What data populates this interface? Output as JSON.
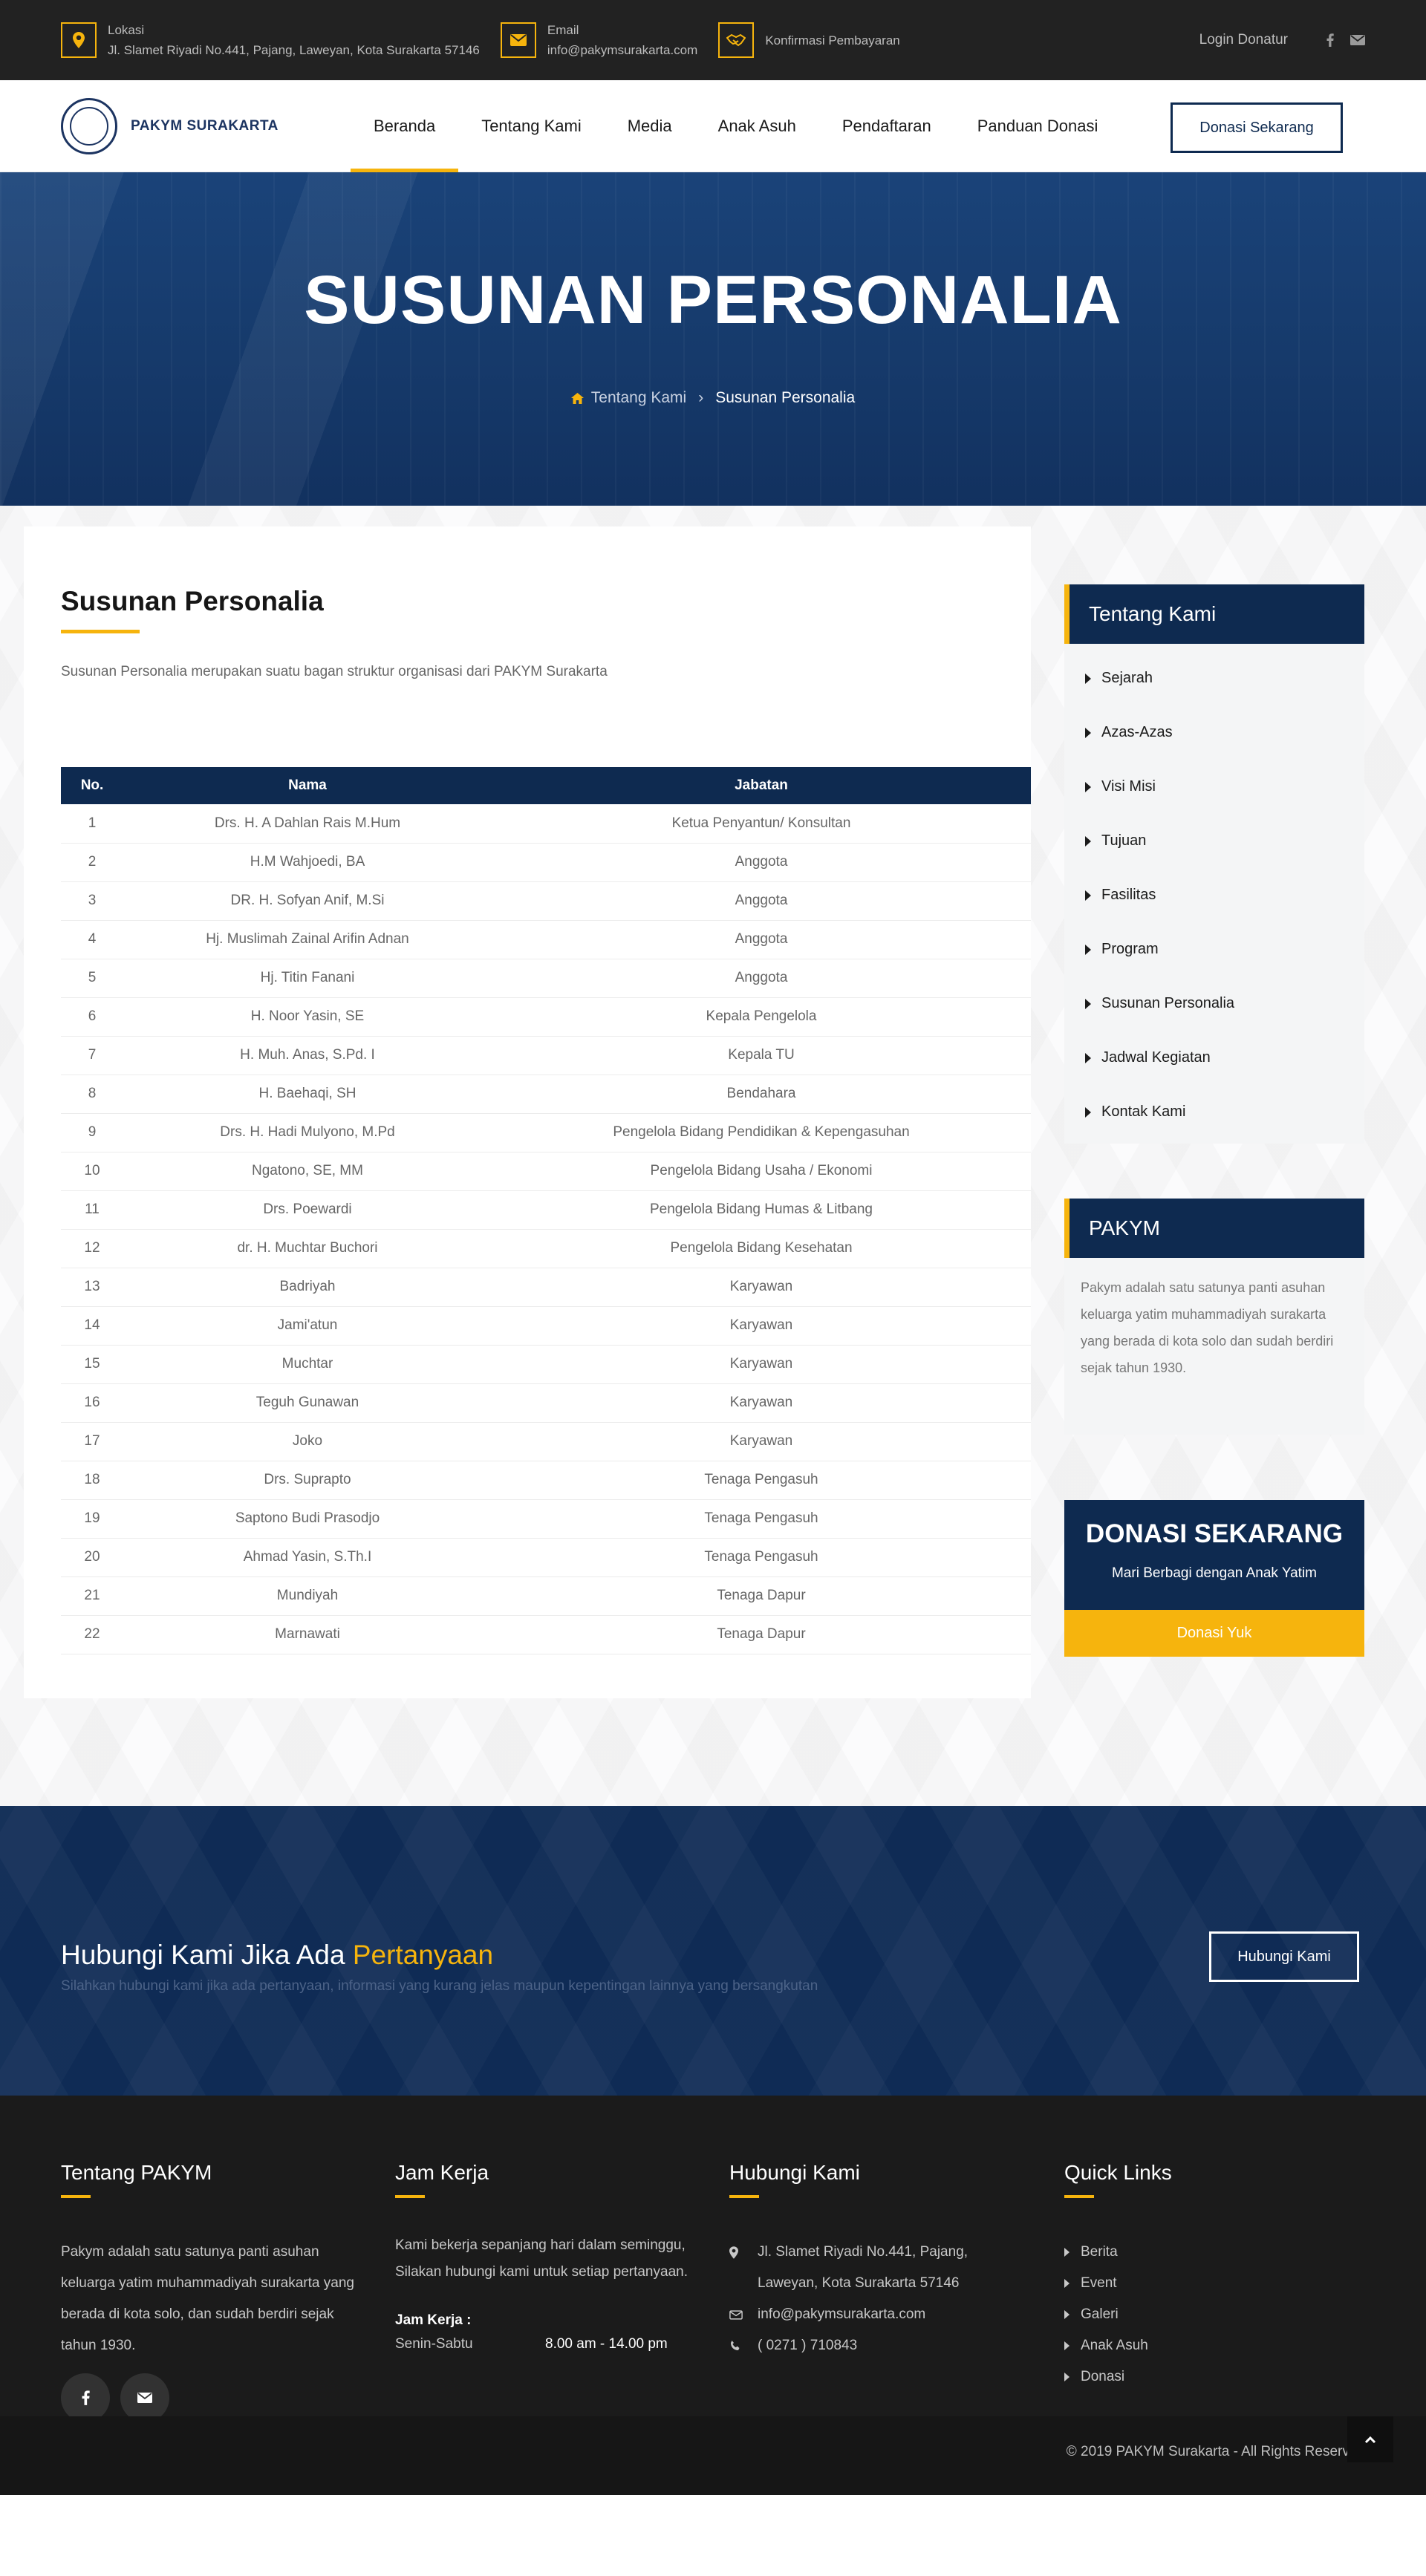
{
  "topbar": {
    "location_label": "Lokasi",
    "location_value": "Jl. Slamet Riyadi No.441, Pajang, Laweyan, Kota Surakarta 57146",
    "email_label": "Email",
    "email_value": "info@pakymsurakarta.com",
    "payment_label": "Konfirmasi Pembayaran",
    "login_label": "Login Donatur"
  },
  "nav": {
    "logo_text": "PAKYM SURAKARTA",
    "items": [
      "Beranda",
      "Tentang Kami",
      "Media",
      "Anak Asuh",
      "Pendaftaran",
      "Panduan Donasi"
    ],
    "active_index": 0,
    "cta_label": "Donasi Sekarang"
  },
  "hero": {
    "title": "SUSUNAN PERSONALIA",
    "breadcrumb_parent": "Tentang Kami",
    "breadcrumb_current": "Susunan Personalia"
  },
  "content": {
    "title": "Susunan Personalia",
    "description": "Susunan Personalia merupakan suatu bagan struktur organisasi dari PAKYM Surakarta",
    "table": {
      "headers": [
        "No.",
        "Nama",
        "Jabatan"
      ],
      "rows": [
        [
          "1",
          "Drs. H. A Dahlan Rais M.Hum",
          "Ketua Penyantun/ Konsultan"
        ],
        [
          "2",
          "H.M Wahjoedi, BA",
          "Anggota"
        ],
        [
          "3",
          "DR. H. Sofyan Anif, M.Si",
          "Anggota"
        ],
        [
          "4",
          "Hj. Muslimah Zainal Arifin Adnan",
          "Anggota"
        ],
        [
          "5",
          "Hj. Titin Fanani",
          "Anggota"
        ],
        [
          "6",
          "H. Noor Yasin, SE",
          "Kepala Pengelola"
        ],
        [
          "7",
          "H. Muh. Anas, S.Pd. I",
          "Kepala TU"
        ],
        [
          "8",
          "H. Baehaqi, SH",
          "Bendahara"
        ],
        [
          "9",
          "Drs. H. Hadi Mulyono, M.Pd",
          "Pengelola Bidang Pendidikan & Kepengasuhan"
        ],
        [
          "10",
          "Ngatono, SE, MM",
          "Pengelola Bidang Usaha / Ekonomi"
        ],
        [
          "11",
          "Drs. Poewardi",
          "Pengelola Bidang Humas & Litbang"
        ],
        [
          "12",
          "dr. H. Muchtar Buchori",
          "Pengelola Bidang Kesehatan"
        ],
        [
          "13",
          "Badriyah",
          "Karyawan"
        ],
        [
          "14",
          "Jami'atun",
          "Karyawan"
        ],
        [
          "15",
          "Muchtar",
          "Karyawan"
        ],
        [
          "16",
          "Teguh Gunawan",
          "Karyawan"
        ],
        [
          "17",
          "Joko",
          "Karyawan"
        ],
        [
          "18",
          "Drs. Suprapto",
          "Tenaga Pengasuh"
        ],
        [
          "19",
          "Saptono Budi Prasodjo",
          "Tenaga Pengasuh"
        ],
        [
          "20",
          "Ahmad Yasin, S.Th.I",
          "Tenaga Pengasuh"
        ],
        [
          "21",
          "Mundiyah",
          "Tenaga Dapur"
        ],
        [
          "22",
          "Marnawati",
          "Tenaga Dapur"
        ]
      ]
    }
  },
  "sidebar": {
    "about_title": "Tentang Kami",
    "about_items": [
      "Sejarah",
      "Azas-Azas",
      "Visi Misi",
      "Tujuan",
      "Fasilitas",
      "Program",
      "Susunan Personalia",
      "Jadwal Kegiatan",
      "Kontak Kami"
    ],
    "pakym_title": "PAKYM",
    "pakym_text": "Pakym adalah satu satunya panti asuhan keluarga yatim muhammadiyah surakarta yang berada di kota solo dan sudah berdiri sejak tahun 1930.",
    "donate_title": "DONASI SEKARANG",
    "donate_subtitle": "Mari Berbagi dengan Anak Yatim",
    "donate_button": "Donasi Yuk"
  },
  "cta": {
    "title_main": "Hubungi Kami Jika Ada ",
    "title_accent": "Pertanyaan",
    "subtitle": "Silahkan hubungi kami jika ada pertanyaan, informasi yang kurang jelas maupun kepentingan lainnya yang bersangkutan",
    "button": "Hubungi Kami"
  },
  "footer": {
    "about_title": "Tentang PAKYM",
    "about_text": "Pakym adalah satu satunya panti asuhan keluarga yatim muhammadiyah surakarta yang berada di kota solo, dan sudah berdiri sejak tahun 1930.",
    "hours_title": "Jam Kerja",
    "hours_text": "Kami bekerja sepanjang hari dalam seminggu, Silakan hubungi kami untuk setiap pertanyaan.",
    "hours_label": "Jam Kerja :",
    "hours_days": "Senin-Sabtu",
    "hours_time": "8.00 am - 14.00 pm",
    "contact_title": "Hubungi Kami",
    "contact_address": "Jl. Slamet Riyadi No.441, Pajang, Laweyan, Kota Surakarta 57146",
    "contact_email": "info@pakymsurakarta.com",
    "contact_phone": "( 0271 ) 710843",
    "links_title": "Quick Links",
    "links": [
      "Berita",
      "Event",
      "Galeri",
      "Anak Asuh",
      "Donasi"
    ],
    "copyright": "© 2019 PAKYM Surakarta - All Rights Reserved"
  },
  "colors": {
    "accent": "#f6b40d",
    "navy": "#0e2a50",
    "dark": "#222222"
  }
}
